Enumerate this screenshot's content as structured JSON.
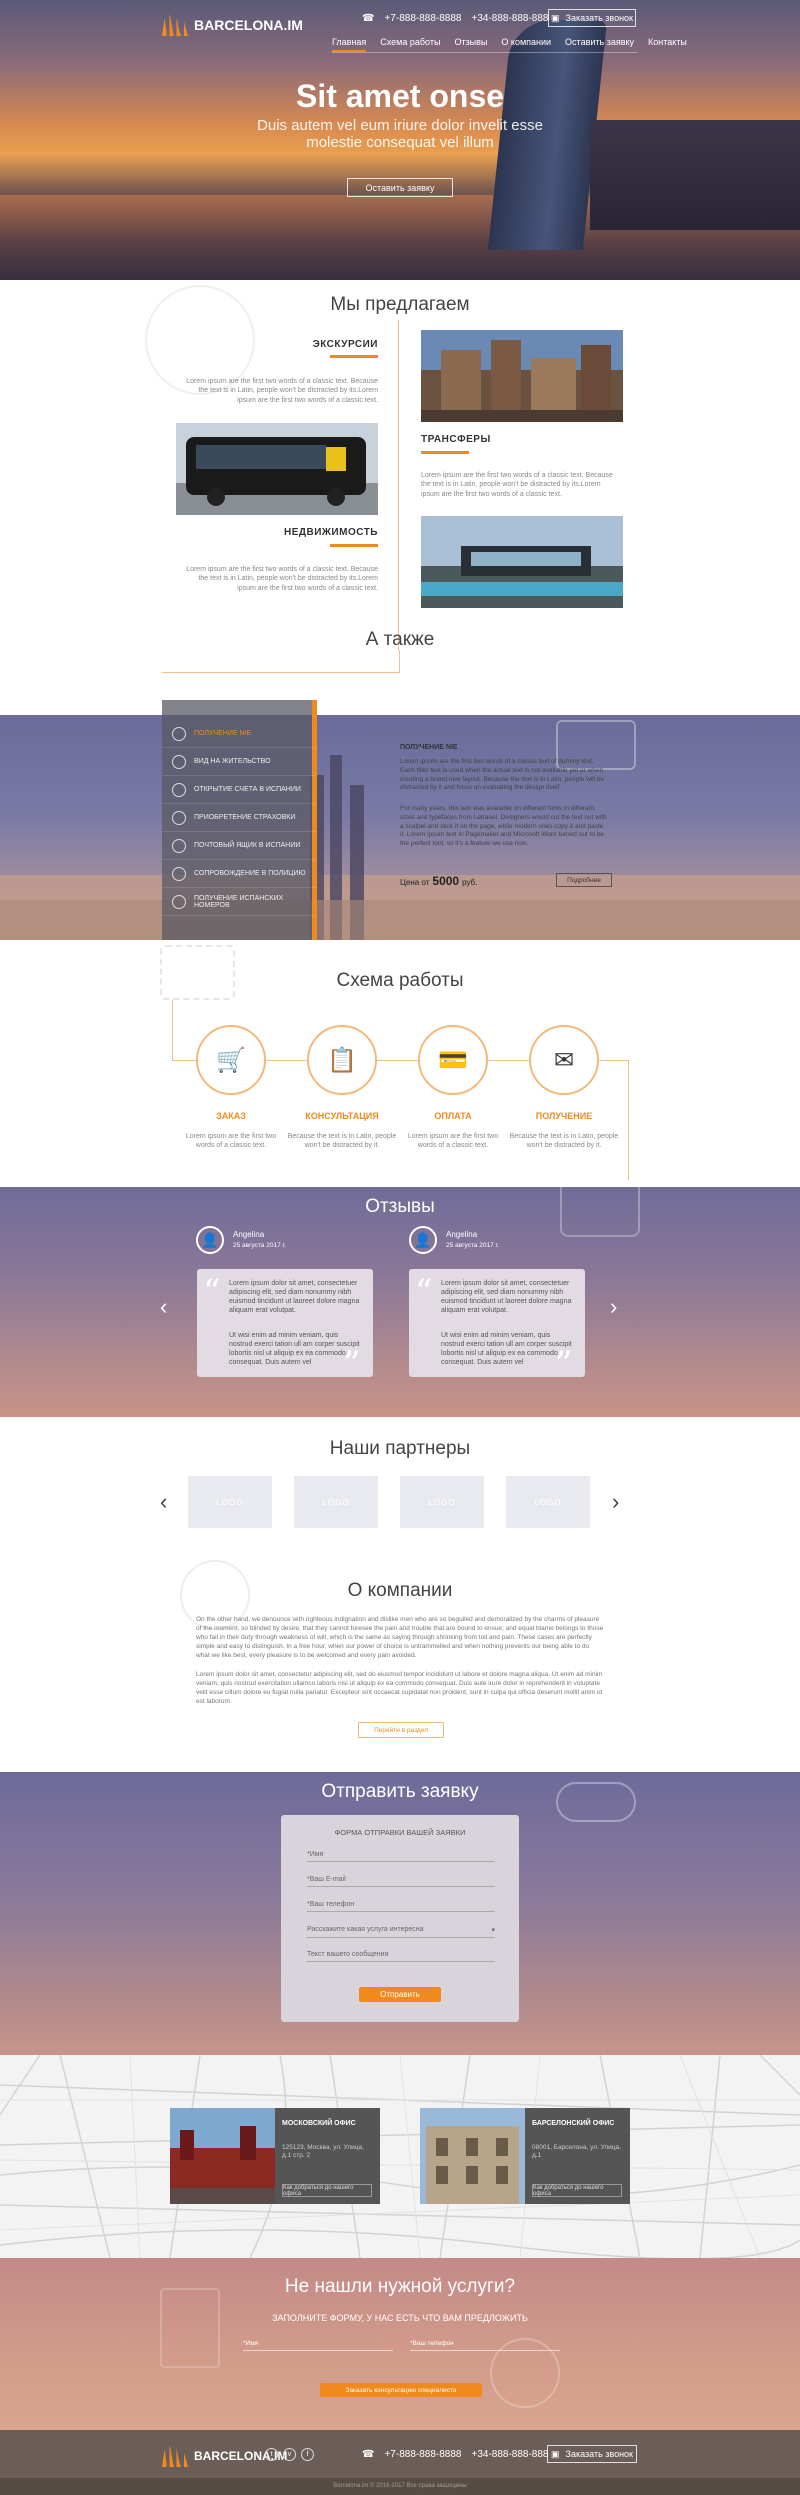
{
  "header": {
    "logo": "BARCELONA.IM",
    "phone1": "+7-888-888-8888",
    "phone2": "+34-888-888-888",
    "order_call": "Заказать звонок",
    "nav": [
      "Главная",
      "Схема работы",
      "Отзывы",
      "О компании",
      "Оставить заявку",
      "Контакты"
    ]
  },
  "hero": {
    "title": "Sit amet onse",
    "subtitle": "Duis autem vel eum iriure dolor invelit esse molestie consequat vel illum",
    "button": "Оставить заявку"
  },
  "offer": {
    "heading": "Мы предлагаем",
    "items": [
      {
        "title": "ЭКСКУРСИИ",
        "text": "Lorem ipsum are the first two words of a classic text. Because the text is in Latin, people won't be distracted by its.Lorem ipsum are the first two words of a classic text."
      },
      {
        "title": "ТРАНСФЕРЫ",
        "text": "Lorem ipsum are the first two words of a classic text. Because the text is in Latin, people won't be distracted by its.Lorem ipsum are the first two words of a classic text."
      },
      {
        "title": "НЕДВИЖИМОСТЬ",
        "text": "Lorem ipsum are the first two words of a classic text. Because the text is in Latin, people won't be distracted by its.Lorem ipsum are the first two words of a classic text."
      }
    ]
  },
  "also": {
    "heading": "А также",
    "menu": [
      "ПОЛУЧЕНИЕ NIE",
      "ВИД НА ЖИТЕЛЬСТВО",
      "ОТКРЫТИЕ СЧЕТА В ИСПАНИИ",
      "ПРИОБРЕТЕНИЕ СТРАХОВКИ",
      "ПОЧТОВЫЙ ЯЩИК В ИСПАНИИ",
      "СОПРОВОЖДЕНИЕ В ПОЛИЦИЮ",
      "ПОЛУЧЕНИЕ ИСПАНСКИХ НОМЕРОВ"
    ],
    "detail_title": "ПОЛУЧЕНИЕ NIE",
    "detail_text1": "Lorem ipsum are the first two words of a classic text of dummy text. Each filler text is used when the actual text is not available yet or when creating a brand new layout. Because the text is in Latin, people will be distracted by it and focus on evaluating the design itself.",
    "detail_text2": "For many years, this text was available on different fonts in different sizes and typefaces from Letraset. Designers would cut the text out with a scalpel and stick it on the page, while modern ones copy it and paste it. Lorem ipsum text in Pagemaker and Microsoft Word turned out to be the perfect tool, so it's a feature we use now.",
    "price_label": "Цена от",
    "price_value": "5000",
    "price_currency": "руб.",
    "detail_button": "Подробнее"
  },
  "scheme": {
    "heading": "Схема работы",
    "steps": [
      {
        "title": "ЗАКАЗ",
        "text": "Lorem ipsum are the first two words of a classic text."
      },
      {
        "title": "КОНСУЛЬТАЦИЯ",
        "text": "Because the text is in Latin, people won't be distracted by it."
      },
      {
        "title": "ОПЛАТА",
        "text": "Lorem ipsum are the first two words of a classic text."
      },
      {
        "title": "ПОЛУЧЕНИЕ",
        "text": "Because the text is in Latin, people won't be distracted by it."
      }
    ]
  },
  "reviews": {
    "heading": "Отзывы",
    "items": [
      {
        "name": "Angelina",
        "date": "25 августа 2017 г.",
        "p1": "Lorem ipsum dolor sit amet, consectetuer adipiscing elit, sed diam nonummy nibh euismod tincidunt ut laoreet dolore magna aliquam erat volutpat.",
        "p2": "Ut wisi enim ad minim veniam, quis nostrud exerci tation ull am corper suscipit lobortis nisl ut aliquip ex ea commodo consequat. Duis autem vel"
      },
      {
        "name": "Angelina",
        "date": "25 августа 2017 г.",
        "p1": "Lorem ipsum dolor sit amet, consectetuer adipiscing elit, sed diam nonummy nibh euismod tincidunt ut laoreet dolore magna aliquam erat volutpat.",
        "p2": "Ut wisi enim ad minim veniam, quis nostrud exerci tation ull am corper suscipit lobortis nisl ut aliquip ex ea commodo consequat. Duis autem vel"
      }
    ]
  },
  "partners": {
    "heading": "Наши партнеры",
    "logos": [
      "LOGO",
      "LOGO",
      "LOGO",
      "LOGO"
    ]
  },
  "about": {
    "heading": "О компании",
    "p1": "On the other hand, we denounce with righteous indignation and dislike men who are so beguiled and demoralized by the charms of pleasure of the moment, so blinded by desire, that they cannot foresee the pain and trouble that are bound to ensue; and equal blame belongs to those who fail in their duty through weakness of will, which is the same as saying through shrinking from toil and pain. These cases are perfectly simple and easy to distinguish. In a free hour, when our power of choice is untrammelled and when nothing prevents our being able to do what we like best, every pleasure is to be welcomed and every pain avoided.",
    "p2": "Lorem ipsum dolor sit amet, consectetur adipiscing elit, sed do eiusmod tempor incididunt ut labore et dolore magna aliqua. Ut enim ad minim veniam, quis nostrud exercitation ullamco laboris nisi ut aliquip ex ea commodo consequat. Duis aute irure dolor in reprehenderit in voluptate velit esse cillum dolore eu fugiat nulla pariatur. Excepteur sint occaecat cupidatat non proident, sunt in culpa qui officia deserunt mollit anim id est laborum.",
    "button": "Перейти в раздел"
  },
  "send": {
    "heading": "Отправить заявку",
    "form_title": "ФОРМА ОТПРАВКИ ВАШЕЙ ЗАЯВКИ",
    "fields": [
      "*Имя",
      "*Ваш E-mail",
      "*Ваш телефон",
      "Расскажите какая услуга интересна",
      "Текст вашего сообщения"
    ],
    "button": "Отправить"
  },
  "offices": [
    {
      "title": "МОСКОВСКИЙ ОФИС",
      "address": "125123, Москва, ул. Улица, д.1 стр. 2",
      "button": "Как добраться до нашего офиса"
    },
    {
      "title": "БАРСЕЛОНСКИЙ ОФИС",
      "address": "08001, Барселона, ул. Улица, д.1",
      "button": "Как добраться до нашего офиса"
    }
  ],
  "notfound": {
    "heading": "Не нашли нужной услуги?",
    "sub": "ЗАПОЛНИТЕ ФОРМУ, У НАС ЕСТЬ ЧТО ВАМ ПРЕДЛОЖИТЬ",
    "name_ph": "*Имя",
    "phone_ph": "*Ваш телефон",
    "button": "Заказать консультацию специалиста"
  },
  "footer": {
    "logo": "BARCELONA.IM",
    "phone1": "+7-888-888-8888",
    "phone2": "+34-888-888-888",
    "order_call": "Заказать звонок",
    "copyright": "Barcelona.im © 2016-2017 Все права защищены"
  },
  "colors": {
    "accent": "#f08a1c"
  }
}
